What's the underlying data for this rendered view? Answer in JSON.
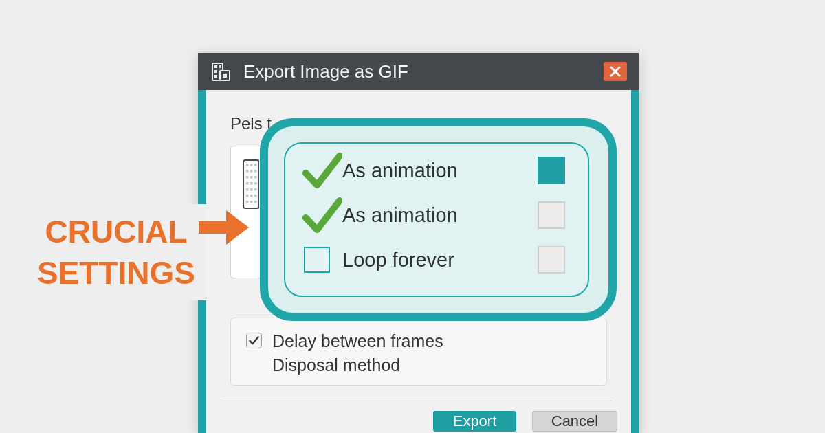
{
  "dialog": {
    "title": "Export Image as GIF",
    "section_label": "Pels t",
    "options": [
      {
        "kind": "checkbox",
        "label": "Delay between frames",
        "checked": true
      },
      {
        "kind": "label",
        "label": "Disposal method"
      }
    ],
    "buttons": [
      {
        "label": "Export",
        "primary": true
      },
      {
        "label": "Cancel",
        "primary": false
      }
    ]
  },
  "highlight": {
    "rows": [
      {
        "label": "As animation",
        "checked": true,
        "filled": true
      },
      {
        "label": "As animation",
        "checked": true,
        "filled": false
      },
      {
        "label": "Loop forever",
        "checked": false,
        "filled": false
      }
    ]
  },
  "callout": {
    "text": "CRUCIAL SETTINGS"
  }
}
